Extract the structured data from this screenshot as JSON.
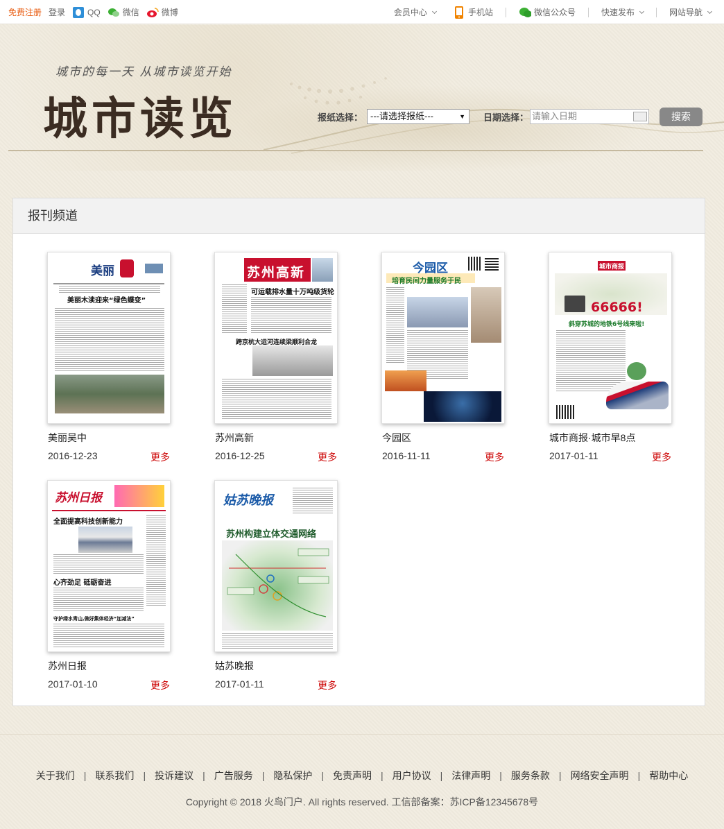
{
  "topbar": {
    "register": "免费注册",
    "login": "登录",
    "qq": "QQ",
    "wechat": "微信",
    "weibo": "微博",
    "member_center": "会员中心",
    "mobile_site": "手机站",
    "wechat_official": "微信公众号",
    "quick_publish": "快速发布",
    "site_nav": "网站导航"
  },
  "header": {
    "slogan": "城市的每一天 从城市读览开始",
    "logo": "城市读览",
    "paper_label": "报纸选择：",
    "paper_select_value": "---请选择报纸---",
    "date_label": "日期选择：",
    "date_placeholder": "请输入日期",
    "search_button": "搜索"
  },
  "panel": {
    "title": "报刊频道",
    "more_label": "更多",
    "items": [
      {
        "name": "美丽吴中",
        "date": "2016-12-23"
      },
      {
        "name": "苏州高新",
        "date": "2016-12-25"
      },
      {
        "name": "今园区",
        "date": "2016-11-11"
      },
      {
        "name": "城市商报·城市早8点",
        "date": "2017-01-11"
      },
      {
        "name": "苏州日报",
        "date": "2017-01-10"
      },
      {
        "name": "姑苏晚报",
        "date": "2017-01-11"
      }
    ]
  },
  "thumbs": {
    "t0": {
      "masthead": "美丽",
      "headline": "美丽木渎迎来“绿色蝶变”"
    },
    "t1": {
      "masthead": "苏州高新",
      "headline1": "可运载排水量十万吨级货轮",
      "headline2": "跨京杭大运河连续梁顺利合龙"
    },
    "t2": {
      "masthead": "今园区",
      "headline": "培育民间力量服务于民"
    },
    "t3": {
      "masthead": "城市商报",
      "big": "66666!",
      "headline": "斜穿苏城的地铁6号线来啦!"
    },
    "t4": {
      "masthead": "苏州日报",
      "headline1": "全面提高科技创新能力",
      "headline2": "心齐劲足 砥砺奋进",
      "headline3": "守护绿水青山,做好集体经济“加减法”"
    },
    "t5": {
      "masthead": "姑苏晚报",
      "headline": "苏州构建立体交通网络"
    }
  },
  "footer": {
    "links": [
      "关于我们",
      "联系我们",
      "投诉建议",
      "广告服务",
      "隐私保护",
      "免责声明",
      "用户协议",
      "法律声明",
      "服务条款",
      "网络安全声明",
      "帮助中心"
    ],
    "copyright": "Copyright © 2018 火鸟门户. All rights reserved. 工信部备案：苏ICP备12345678号"
  }
}
